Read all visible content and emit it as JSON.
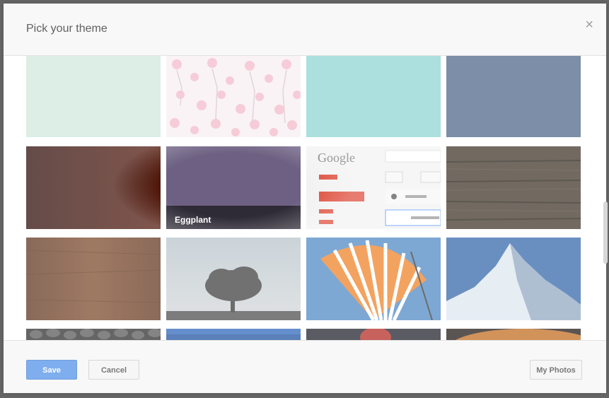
{
  "dialog": {
    "title": "Pick your theme",
    "close_label": "×"
  },
  "themes": [
    {
      "name": "mint",
      "color": "#cfe7dc"
    },
    {
      "name": "cherry-blossom",
      "color": "#f4ecef"
    },
    {
      "name": "teal",
      "color": "#8bd4d1"
    },
    {
      "name": "navy",
      "color": "#4a6286"
    },
    {
      "name": "dark-red",
      "color": "#3a0f07"
    },
    {
      "name": "eggplant",
      "color": "#6d6082",
      "label": "Eggplant"
    },
    {
      "name": "classic-gmail",
      "color": "#f2f2f2",
      "brand": "Google"
    },
    {
      "name": "wood-dark",
      "color": "#3b3023"
    },
    {
      "name": "wood-brown",
      "color": "#6b3c1f"
    },
    {
      "name": "tree",
      "color": "#b9c2c8"
    },
    {
      "name": "umbrella",
      "color": "#4b86c4"
    },
    {
      "name": "mountain",
      "color": "#2f64a8"
    },
    {
      "name": "pebbles",
      "color": "#333"
    },
    {
      "name": "blue-sky",
      "color": "#1c4f9f"
    },
    {
      "name": "dark-red-abstract",
      "color": "#1c1c28"
    },
    {
      "name": "orange-planet",
      "color": "#1a1410"
    }
  ],
  "footer": {
    "save_label": "Save",
    "cancel_label": "Cancel",
    "my_photos_label": "My Photos"
  }
}
